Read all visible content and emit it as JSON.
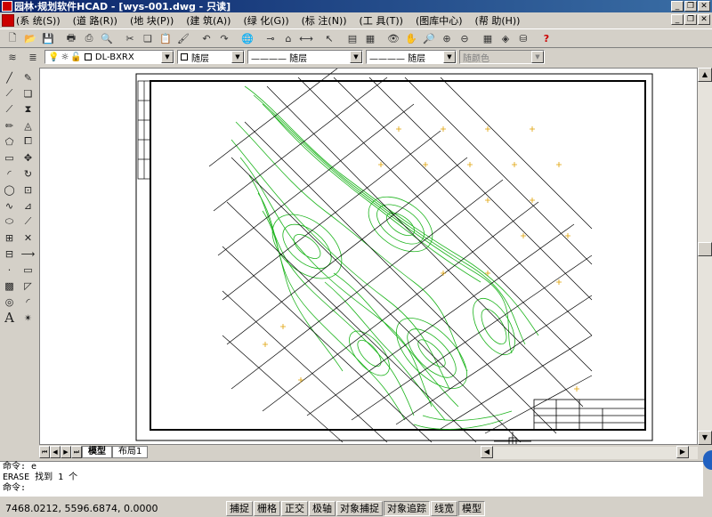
{
  "window": {
    "title": "园林·规划软件HCAD - [wys-001.dwg - 只读]"
  },
  "menu": [
    "(系 统(S))",
    "(道 路(R))",
    "(地 块(P))",
    "(建 筑(A))",
    "(绿 化(G))",
    "(标 注(N))",
    "(工 具(T))",
    "(图库中心)",
    "(帮 助(H))"
  ],
  "layer": {
    "current": "DL-BXRX",
    "color": "随层",
    "linetype": "———— 随层",
    "lineweight": "———— 随层",
    "plotstyle": "随颜色"
  },
  "tabs": {
    "model": "模型",
    "layout1": "布局1"
  },
  "command": {
    "line1": "命令: e",
    "line2": "ERASE 找到 1 个",
    "line3": "命令:"
  },
  "status": {
    "coords": "7468.0212, 5596.6874, 0.0000",
    "toggles": [
      "捕捉",
      "栅格",
      "正交",
      "极轴",
      "对象捕捉",
      "对象追踪",
      "线宽",
      "模型"
    ]
  },
  "colors": {
    "contour": "#1db41d",
    "grid": "#000000",
    "label": "#e0a000",
    "title_bg": "#0a246a"
  }
}
